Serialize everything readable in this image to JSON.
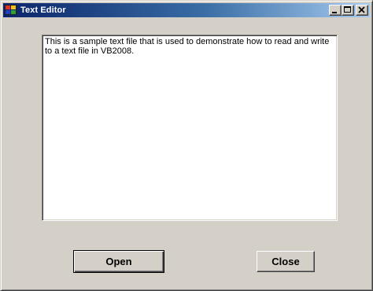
{
  "window": {
    "title": "Text Editor",
    "controls": [
      "minimize-icon",
      "maximize-icon",
      "close-icon"
    ]
  },
  "editor": {
    "content": "This is a sample text file that is used to demonstrate how to read and write to a text file in VB2008."
  },
  "buttons": {
    "open_label": "Open",
    "close_label": "Close"
  },
  "colors": {
    "face": "#d4d0c8",
    "title_start": "#0a246a",
    "title_end": "#a6caf0"
  }
}
